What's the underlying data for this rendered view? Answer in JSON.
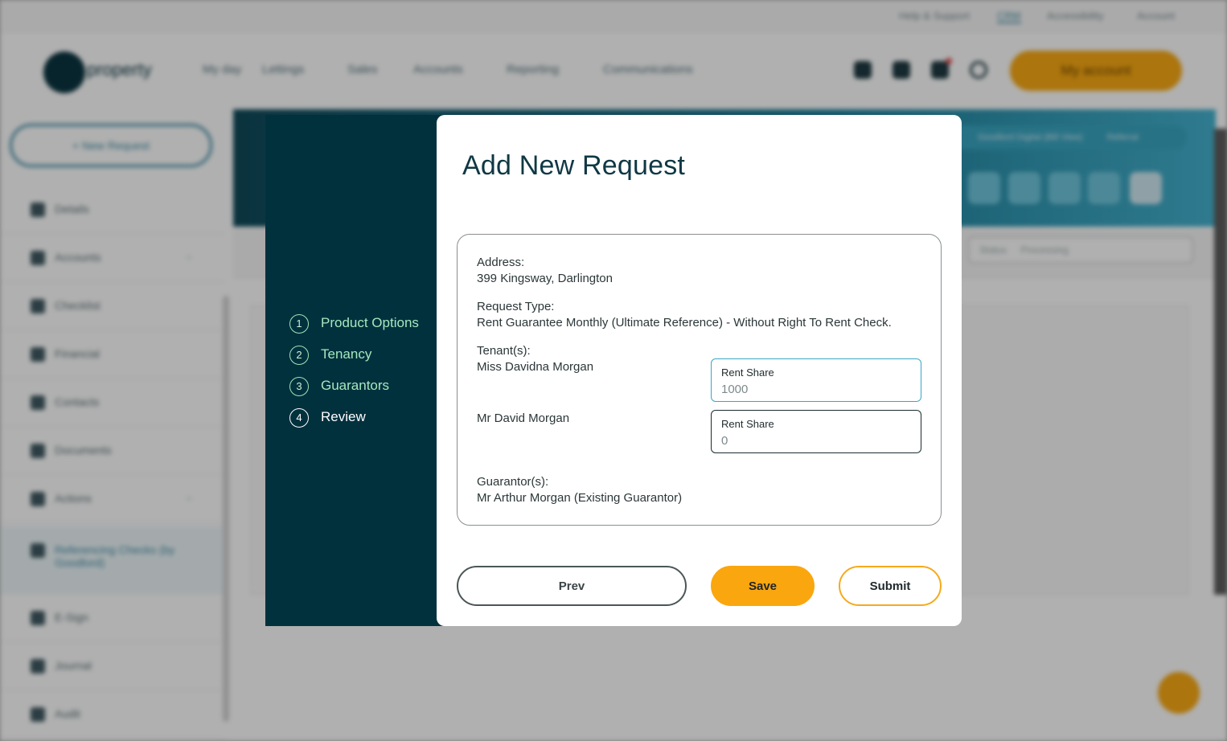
{
  "background": {
    "top_links": [
      "Help & Support",
      "CRM",
      "Accessibility",
      "Account"
    ],
    "logo_text": "property",
    "nav": [
      "My day",
      "Lettings",
      "Sales",
      "Accounts",
      "Reporting",
      "Communications"
    ],
    "account_button": "My account",
    "new_request_button": "+ New Request",
    "sidebar": [
      "Details",
      "Accounts",
      "Checklist",
      "Financial",
      "Contacts",
      "Documents",
      "Actions",
      "Referencing Checks (by Goodlord)",
      "E-Sign",
      "Journal",
      "Audit"
    ],
    "banner_pill": "Goodlord Digital (Bill View)",
    "banner_link": "Referral",
    "filter_label": "Status",
    "filter_value": "Processing"
  },
  "modal": {
    "steps": [
      {
        "num": "1",
        "label": "Product Options"
      },
      {
        "num": "2",
        "label": "Tenancy"
      },
      {
        "num": "3",
        "label": "Guarantors"
      },
      {
        "num": "4",
        "label": "Review"
      }
    ],
    "title": "Add New Request",
    "review": {
      "address_label": "Address:",
      "address_value": "399 Kingsway, Darlington",
      "request_type_label": "Request Type:",
      "request_type_value": "Rent Guarantee Monthly (Ultimate Reference) - Without Right To Rent Check.",
      "tenants_label": "Tenant(s):",
      "tenants": [
        {
          "name": "Miss Davidna Morgan",
          "share_label": "Rent Share",
          "share_value": "1000"
        },
        {
          "name": "Mr David Morgan",
          "share_label": "Rent Share",
          "share_value": "0"
        }
      ],
      "guarantors_label": "Guarantor(s):",
      "guarantor_value": "Mr Arthur Morgan (Existing Guarantor)"
    },
    "buttons": {
      "prev": "Prev",
      "save": "Save",
      "submit": "Submit"
    }
  },
  "colors": {
    "steps_bg": "#02313e",
    "step_text": "#a4e9bd",
    "title": "#0f3844",
    "save_bg": "#faa60f",
    "submit_border": "#f6aa1c",
    "focus_border": "#3aa6c2"
  }
}
